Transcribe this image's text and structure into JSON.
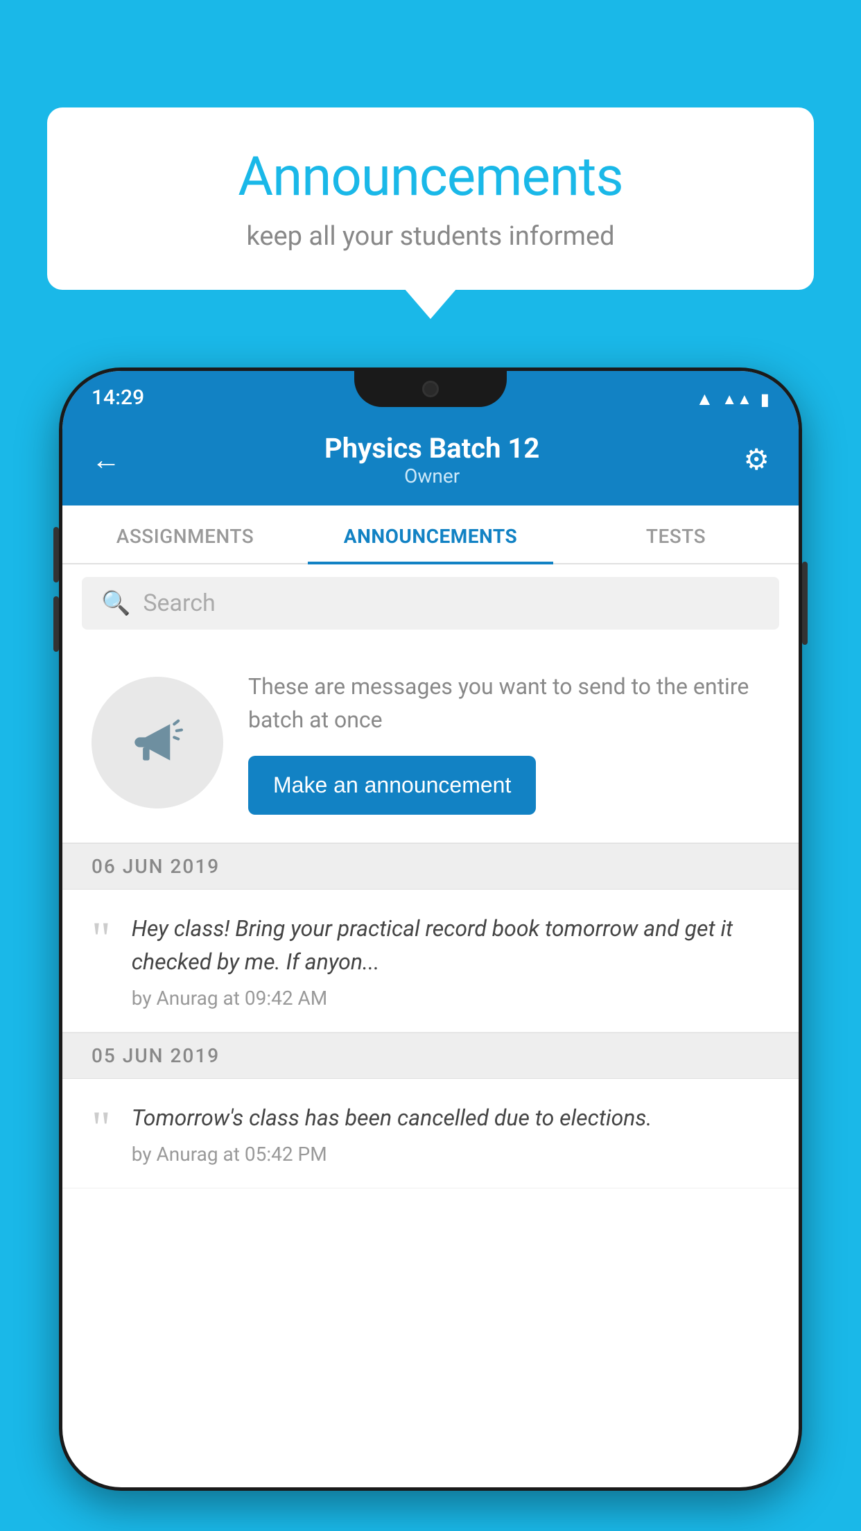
{
  "background_color": "#1ab8e8",
  "speech_bubble": {
    "title": "Announcements",
    "subtitle": "keep all your students informed"
  },
  "phone": {
    "status_bar": {
      "time": "14:29",
      "icons": [
        "wifi",
        "signal",
        "battery"
      ]
    },
    "header": {
      "title": "Physics Batch 12",
      "subtitle": "Owner",
      "back_label": "←",
      "gear_label": "⚙"
    },
    "tabs": [
      {
        "label": "ASSIGNMENTS",
        "active": false
      },
      {
        "label": "ANNOUNCEMENTS",
        "active": true
      },
      {
        "label": "TESTS",
        "active": false
      }
    ],
    "search": {
      "placeholder": "Search"
    },
    "announcement_intro": {
      "description": "These are messages you want to send to the entire batch at once",
      "button_label": "Make an announcement"
    },
    "announcements": [
      {
        "date": "06  JUN  2019",
        "message": "Hey class! Bring your practical record book tomorrow and get it checked by me. If anyon...",
        "author": "by Anurag at 09:42 AM"
      },
      {
        "date": "05  JUN  2019",
        "message": "Tomorrow's class has been cancelled due to elections.",
        "author": "by Anurag at 05:42 PM"
      }
    ]
  }
}
